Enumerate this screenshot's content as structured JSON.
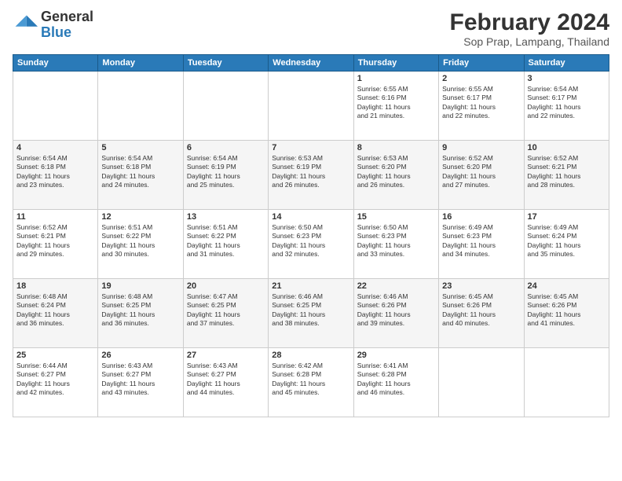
{
  "logo": {
    "general": "General",
    "blue": "Blue"
  },
  "title": "February 2024",
  "subtitle": "Sop Prap, Lampang, Thailand",
  "days_header": [
    "Sunday",
    "Monday",
    "Tuesday",
    "Wednesday",
    "Thursday",
    "Friday",
    "Saturday"
  ],
  "weeks": [
    [
      {
        "day": "",
        "info": ""
      },
      {
        "day": "",
        "info": ""
      },
      {
        "day": "",
        "info": ""
      },
      {
        "day": "",
        "info": ""
      },
      {
        "day": "1",
        "info": "Sunrise: 6:55 AM\nSunset: 6:16 PM\nDaylight: 11 hours\nand 21 minutes."
      },
      {
        "day": "2",
        "info": "Sunrise: 6:55 AM\nSunset: 6:17 PM\nDaylight: 11 hours\nand 22 minutes."
      },
      {
        "day": "3",
        "info": "Sunrise: 6:54 AM\nSunset: 6:17 PM\nDaylight: 11 hours\nand 22 minutes."
      }
    ],
    [
      {
        "day": "4",
        "info": "Sunrise: 6:54 AM\nSunset: 6:18 PM\nDaylight: 11 hours\nand 23 minutes."
      },
      {
        "day": "5",
        "info": "Sunrise: 6:54 AM\nSunset: 6:18 PM\nDaylight: 11 hours\nand 24 minutes."
      },
      {
        "day": "6",
        "info": "Sunrise: 6:54 AM\nSunset: 6:19 PM\nDaylight: 11 hours\nand 25 minutes."
      },
      {
        "day": "7",
        "info": "Sunrise: 6:53 AM\nSunset: 6:19 PM\nDaylight: 11 hours\nand 26 minutes."
      },
      {
        "day": "8",
        "info": "Sunrise: 6:53 AM\nSunset: 6:20 PM\nDaylight: 11 hours\nand 26 minutes."
      },
      {
        "day": "9",
        "info": "Sunrise: 6:52 AM\nSunset: 6:20 PM\nDaylight: 11 hours\nand 27 minutes."
      },
      {
        "day": "10",
        "info": "Sunrise: 6:52 AM\nSunset: 6:21 PM\nDaylight: 11 hours\nand 28 minutes."
      }
    ],
    [
      {
        "day": "11",
        "info": "Sunrise: 6:52 AM\nSunset: 6:21 PM\nDaylight: 11 hours\nand 29 minutes."
      },
      {
        "day": "12",
        "info": "Sunrise: 6:51 AM\nSunset: 6:22 PM\nDaylight: 11 hours\nand 30 minutes."
      },
      {
        "day": "13",
        "info": "Sunrise: 6:51 AM\nSunset: 6:22 PM\nDaylight: 11 hours\nand 31 minutes."
      },
      {
        "day": "14",
        "info": "Sunrise: 6:50 AM\nSunset: 6:23 PM\nDaylight: 11 hours\nand 32 minutes."
      },
      {
        "day": "15",
        "info": "Sunrise: 6:50 AM\nSunset: 6:23 PM\nDaylight: 11 hours\nand 33 minutes."
      },
      {
        "day": "16",
        "info": "Sunrise: 6:49 AM\nSunset: 6:23 PM\nDaylight: 11 hours\nand 34 minutes."
      },
      {
        "day": "17",
        "info": "Sunrise: 6:49 AM\nSunset: 6:24 PM\nDaylight: 11 hours\nand 35 minutes."
      }
    ],
    [
      {
        "day": "18",
        "info": "Sunrise: 6:48 AM\nSunset: 6:24 PM\nDaylight: 11 hours\nand 36 minutes."
      },
      {
        "day": "19",
        "info": "Sunrise: 6:48 AM\nSunset: 6:25 PM\nDaylight: 11 hours\nand 36 minutes."
      },
      {
        "day": "20",
        "info": "Sunrise: 6:47 AM\nSunset: 6:25 PM\nDaylight: 11 hours\nand 37 minutes."
      },
      {
        "day": "21",
        "info": "Sunrise: 6:46 AM\nSunset: 6:25 PM\nDaylight: 11 hours\nand 38 minutes."
      },
      {
        "day": "22",
        "info": "Sunrise: 6:46 AM\nSunset: 6:26 PM\nDaylight: 11 hours\nand 39 minutes."
      },
      {
        "day": "23",
        "info": "Sunrise: 6:45 AM\nSunset: 6:26 PM\nDaylight: 11 hours\nand 40 minutes."
      },
      {
        "day": "24",
        "info": "Sunrise: 6:45 AM\nSunset: 6:26 PM\nDaylight: 11 hours\nand 41 minutes."
      }
    ],
    [
      {
        "day": "25",
        "info": "Sunrise: 6:44 AM\nSunset: 6:27 PM\nDaylight: 11 hours\nand 42 minutes."
      },
      {
        "day": "26",
        "info": "Sunrise: 6:43 AM\nSunset: 6:27 PM\nDaylight: 11 hours\nand 43 minutes."
      },
      {
        "day": "27",
        "info": "Sunrise: 6:43 AM\nSunset: 6:27 PM\nDaylight: 11 hours\nand 44 minutes."
      },
      {
        "day": "28",
        "info": "Sunrise: 6:42 AM\nSunset: 6:28 PM\nDaylight: 11 hours\nand 45 minutes."
      },
      {
        "day": "29",
        "info": "Sunrise: 6:41 AM\nSunset: 6:28 PM\nDaylight: 11 hours\nand 46 minutes."
      },
      {
        "day": "",
        "info": ""
      },
      {
        "day": "",
        "info": ""
      }
    ]
  ]
}
